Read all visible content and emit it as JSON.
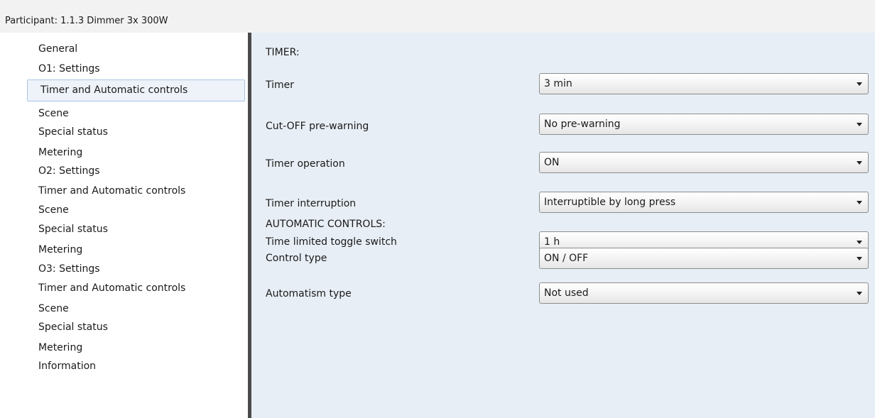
{
  "header": {
    "title": "Participant: 1.1.3  Dimmer 3x 300W"
  },
  "sidebar": {
    "items": [
      {
        "label": "General"
      },
      {
        "label": "O1: Settings"
      },
      {
        "label": "Timer and Automatic controls",
        "selected": true
      },
      {
        "label": "Scene"
      },
      {
        "label": "Special status"
      },
      {
        "label": "Metering"
      },
      {
        "label": "O2: Settings"
      },
      {
        "label": "Timer and Automatic controls"
      },
      {
        "label": "Scene"
      },
      {
        "label": "Special status"
      },
      {
        "label": "Metering"
      },
      {
        "label": "O3: Settings"
      },
      {
        "label": "Timer and Automatic controls"
      },
      {
        "label": "Scene"
      },
      {
        "label": "Special status"
      },
      {
        "label": "Metering"
      },
      {
        "label": "Information"
      }
    ]
  },
  "panel": {
    "timer_section": {
      "title": "TIMER:",
      "params": [
        {
          "label": "Timer",
          "value": "3 min"
        },
        {
          "label": "Cut-OFF pre-warning",
          "value": "No pre-warning"
        },
        {
          "label": "Timer operation",
          "value": "ON"
        },
        {
          "label": "Timer interruption",
          "value": "Interruptible by long press"
        },
        {
          "label": "Time limited toggle switch",
          "value": "1 h"
        }
      ]
    },
    "automatic_section": {
      "title": "AUTOMATIC CONTROLS:",
      "params": [
        {
          "label": "Control type",
          "value": "ON / OFF"
        },
        {
          "label": "Automatism type",
          "value": "Not used"
        }
      ]
    }
  },
  "colors": {
    "panel_background": "#e8eef5",
    "selection_border": "#a9c6e6",
    "selection_background": "#eef3f9",
    "divider": "#4a4a4a"
  },
  "icons": {
    "dropdown": "chevron-down-icon"
  }
}
